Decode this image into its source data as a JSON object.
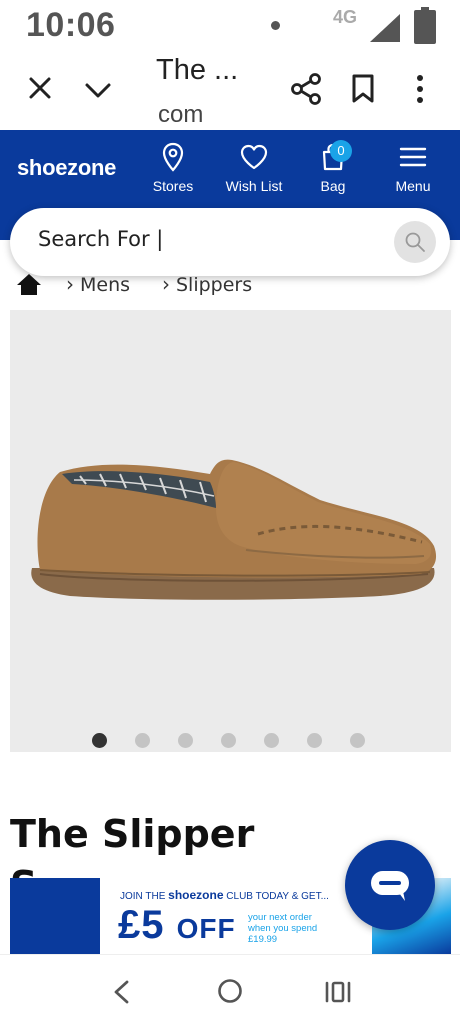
{
  "status_bar": {
    "time": "10:06",
    "network": "4G",
    "icons": [
      "notification-dot-icon",
      "signal-icon",
      "battery-icon"
    ]
  },
  "browser": {
    "title": "The ...",
    "domain": "com",
    "icons": [
      "close-icon",
      "chevron-down-icon",
      "share-icon",
      "bookmark-icon",
      "more-vert-icon"
    ]
  },
  "site": {
    "logo": "shoezone",
    "nav": [
      {
        "label": "Stores",
        "icon": "location-pin-icon"
      },
      {
        "label": "Wish List",
        "icon": "heart-icon"
      },
      {
        "label": "Bag",
        "icon": "shopping-bag-icon",
        "badge": "0"
      },
      {
        "label": "Menu",
        "icon": "hamburger-menu-icon"
      }
    ],
    "header_color": "#0a3a9c",
    "accent_color": "#1aa3e8"
  },
  "search": {
    "value": "Search For |",
    "icon": "search-icon"
  },
  "breadcrumb": {
    "home_icon": "home-icon",
    "items": [
      "Mens",
      "Slippers"
    ]
  },
  "gallery": {
    "image": "slipper-image",
    "total_slides": 7,
    "active_slide": 1
  },
  "product": {
    "title": "The Slipper",
    "title_overflow": "S"
  },
  "promo": {
    "join_prefix": "JOIN THE",
    "join_brand": "shoezone",
    "join_suffix": "CLUB TODAY & GET...",
    "amount": "£5",
    "off": "OFF",
    "sub_line1": "your next order",
    "sub_line2": "when you spend",
    "sub_line3": "£19.99"
  },
  "chat": {
    "icon": "chat-bubble-icon"
  },
  "system_nav": {
    "icons": [
      "back-icon",
      "home-circle-icon",
      "recent-apps-icon"
    ]
  }
}
